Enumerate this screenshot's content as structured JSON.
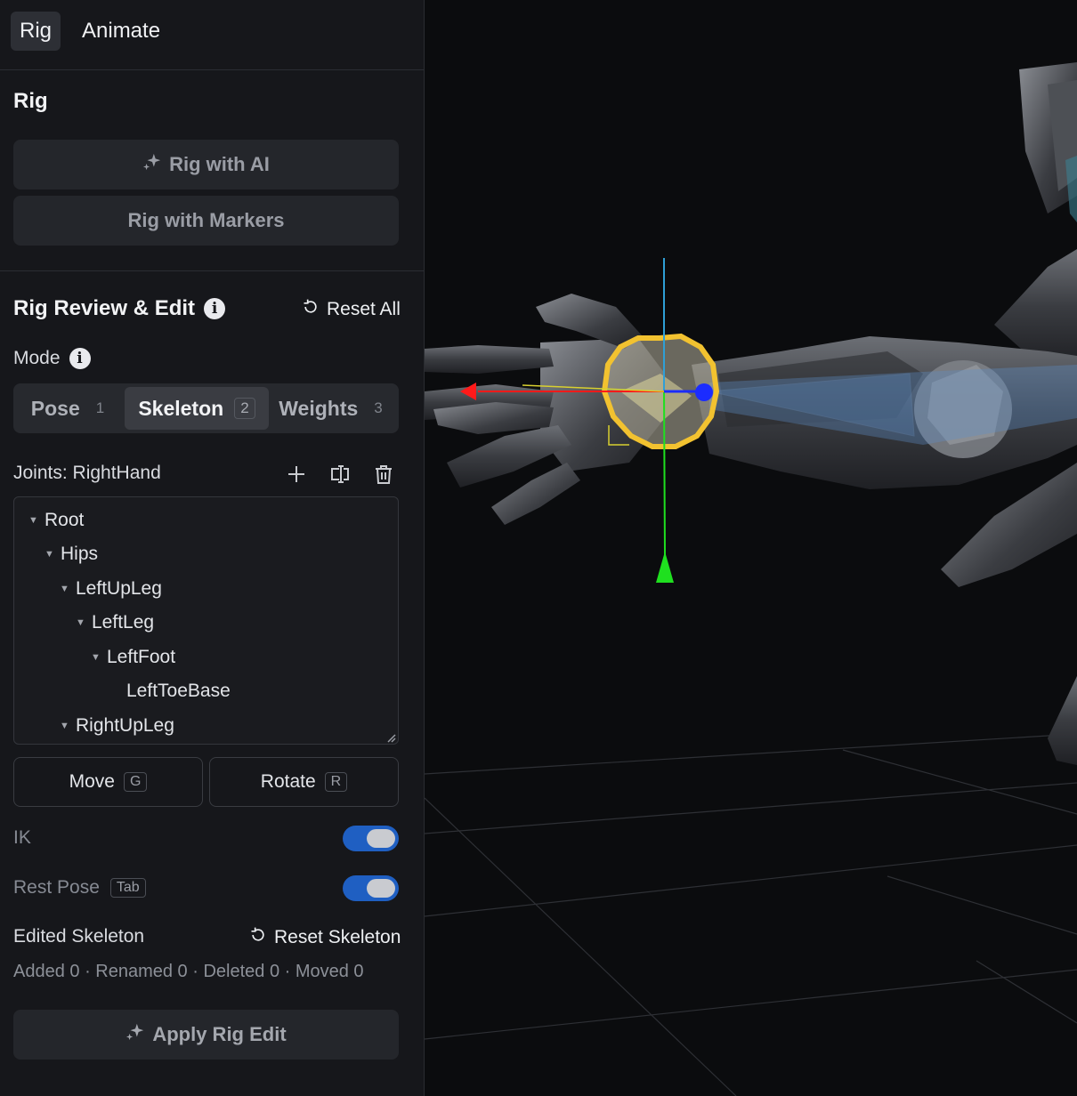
{
  "tabs": [
    {
      "label": "Rig",
      "active": true
    },
    {
      "label": "Animate",
      "active": false
    }
  ],
  "rig_section": {
    "title": "Rig",
    "rig_ai_label": "Rig with AI",
    "rig_markers_label": "Rig with Markers"
  },
  "review": {
    "title": "Rig Review & Edit",
    "reset_all_label": "Reset All",
    "mode_label": "Mode",
    "modes": [
      {
        "label": "Pose",
        "key": "1",
        "active": false
      },
      {
        "label": "Skeleton",
        "key": "2",
        "active": true
      },
      {
        "label": "Weights",
        "key": "3",
        "active": false
      }
    ],
    "joints_label": "Joints: RightHand",
    "tree": [
      {
        "label": "Root",
        "depth": 0,
        "expanded": true
      },
      {
        "label": "Hips",
        "depth": 1,
        "expanded": true
      },
      {
        "label": "LeftUpLeg",
        "depth": 2,
        "expanded": true
      },
      {
        "label": "LeftLeg",
        "depth": 3,
        "expanded": true
      },
      {
        "label": "LeftFoot",
        "depth": 4,
        "expanded": true
      },
      {
        "label": "LeftToeBase",
        "depth": 5,
        "expanded": null
      },
      {
        "label": "RightUpLeg",
        "depth": 2,
        "expanded": true
      }
    ],
    "move_label": "Move",
    "move_key": "G",
    "rotate_label": "Rotate",
    "rotate_key": "R",
    "ik_label": "IK",
    "ik_on": true,
    "rest_pose_label": "Rest Pose",
    "rest_pose_key": "Tab",
    "rest_pose_on": true,
    "edited_label": "Edited Skeleton",
    "reset_skeleton_label": "Reset Skeleton",
    "stats": "Added 0 · Renamed 0 · Deleted 0 · Moved 0",
    "apply_label": "Apply Rig Edit"
  },
  "colors": {
    "accent_toggle": "#1f5fc2",
    "joint_highlight": "#f2c230",
    "axis_x": "#ff1a1a",
    "axis_y": "#1fe01f",
    "axis_z": "#1b2cff",
    "bone": "#5f8fc8"
  },
  "icons": {
    "sparkle": "sparkle-icon",
    "info": "info-icon",
    "reset": "reset-icon",
    "add": "plus-icon",
    "rename": "rename-icon",
    "delete": "trash-icon"
  }
}
